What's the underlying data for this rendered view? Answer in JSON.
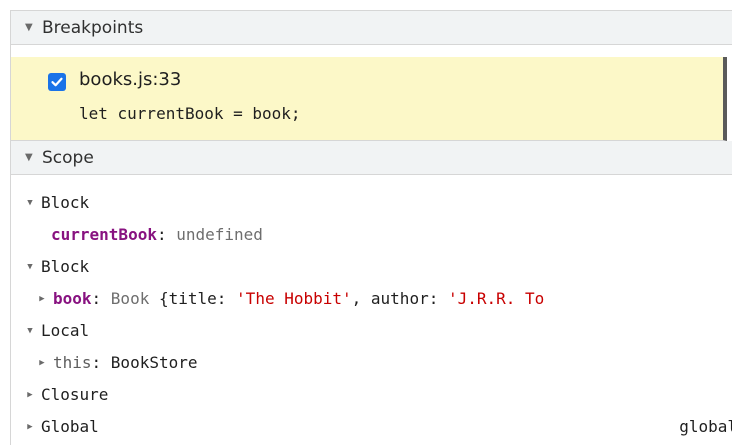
{
  "breakpoints": {
    "header": "Breakpoints",
    "entry": {
      "file": "books.js:33",
      "code": "let currentBook = book;",
      "checked": true
    }
  },
  "scope": {
    "header": "Scope",
    "rows": {
      "block1": {
        "label": "Block",
        "expanded": true
      },
      "current_book": {
        "key": "currentBook",
        "value": "undefined"
      },
      "block2": {
        "label": "Block",
        "expanded": true
      },
      "book": {
        "key": "book",
        "class_name": "Book ",
        "open_brace": "{",
        "title_key": "title: ",
        "title_value": "'The Hobbit'",
        "sep": ", ",
        "author_key": "author: ",
        "author_value": "'J.R.R. To"
      },
      "local": {
        "label": "Local",
        "expanded": true
      },
      "this": {
        "key": "this",
        "value": "BookStore"
      },
      "closure": {
        "label": "Closure",
        "expanded": false
      },
      "global": {
        "label": "Global",
        "expanded": false,
        "right_value": "global"
      }
    }
  },
  "colors": {
    "checkbox": "#1a73e8",
    "breakpoint_bg": "#fcf8c8",
    "key_purple": "#881280",
    "string_red": "#c80000"
  }
}
